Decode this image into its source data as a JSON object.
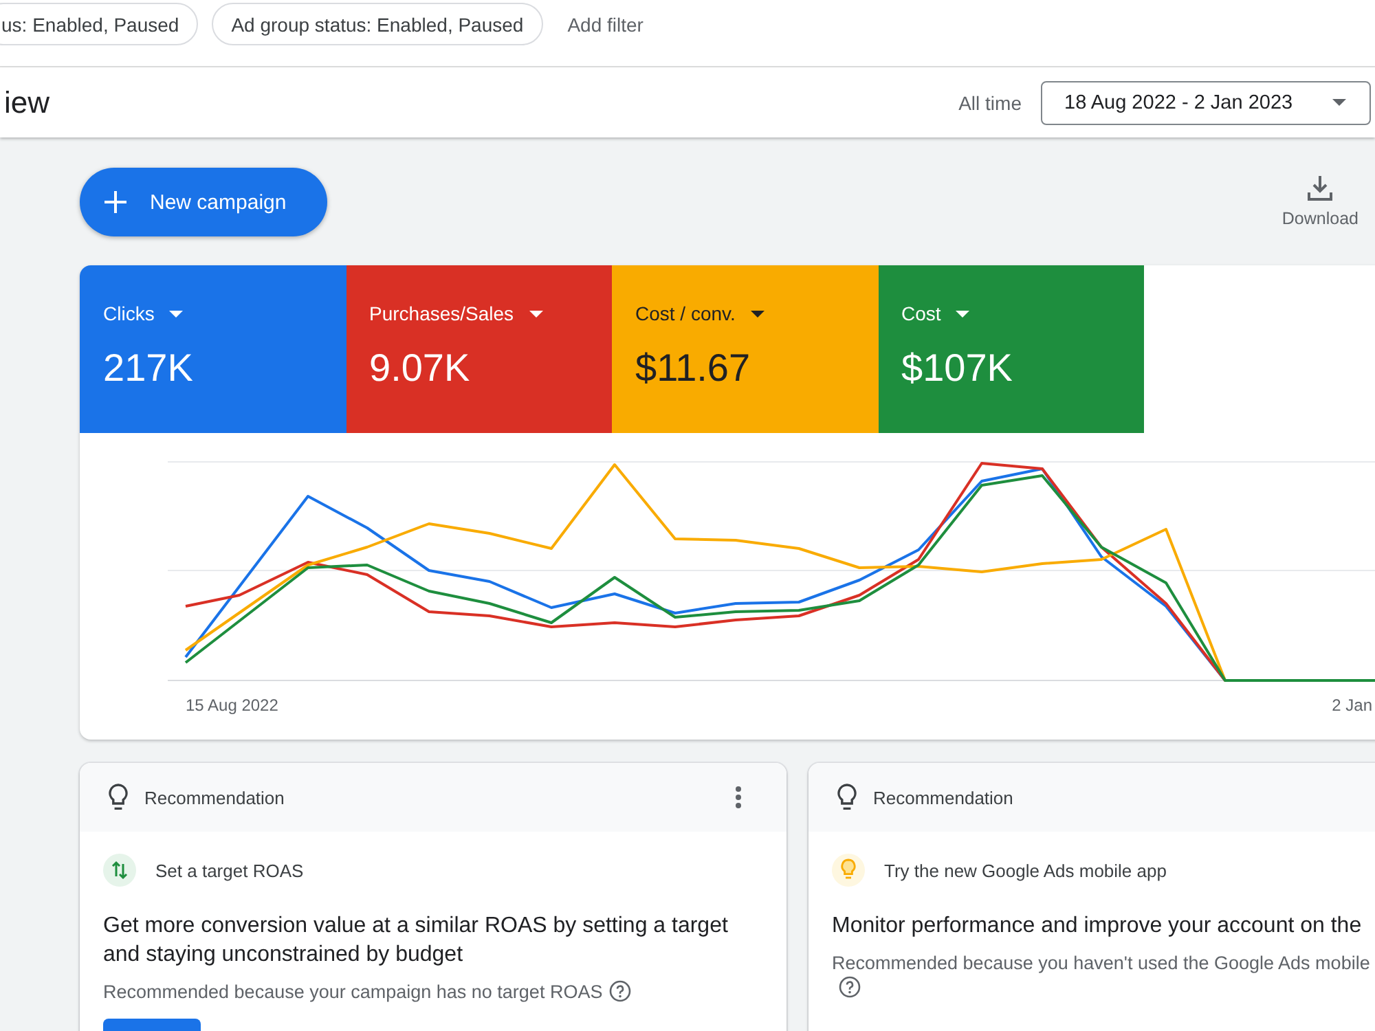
{
  "filters": [
    {
      "label": "us: Enabled, Paused"
    },
    {
      "label": "Ad group status: Enabled, Paused"
    }
  ],
  "add_filter": "Add filter",
  "header": {
    "title": "iew",
    "date_preset": "All time",
    "date_range": "18 Aug 2022 - 2 Jan 2023"
  },
  "toolbar": {
    "new_campaign": "New campaign",
    "download": "Download"
  },
  "metrics": [
    {
      "label": "Clicks",
      "value": "217K",
      "color": "#1a73e8",
      "selected": true
    },
    {
      "label": "Purchases/Sales",
      "value": "9.07K",
      "color": "#d93025",
      "selected": true
    },
    {
      "label": "Cost / conv.",
      "value": "$11.67",
      "color": "#f9ab00",
      "selected": true
    },
    {
      "label": "Cost",
      "value": "$107K",
      "color": "#1e8e3e",
      "selected": true
    }
  ],
  "chart": {
    "start_label": "15 Aug 2022",
    "end_label": "2 Jan"
  },
  "recommendations": [
    {
      "kind": "target_roas",
      "header": "Recommendation",
      "more_menu": true,
      "title": "Set a target ROAS",
      "headline": "Get more conversion value at a similar ROAS by setting a target and staying unconstrained by budget",
      "reason": "Recommended because your campaign has no target ROAS",
      "action_button": true
    },
    {
      "kind": "mobile_app",
      "header": "Recommendation",
      "more_menu": false,
      "title": "Try the new Google Ads mobile app",
      "headline": "Monitor performance and improve your account on the",
      "reason": "Recommended because you haven't used the Google Ads mobile",
      "action_button": false
    }
  ]
}
